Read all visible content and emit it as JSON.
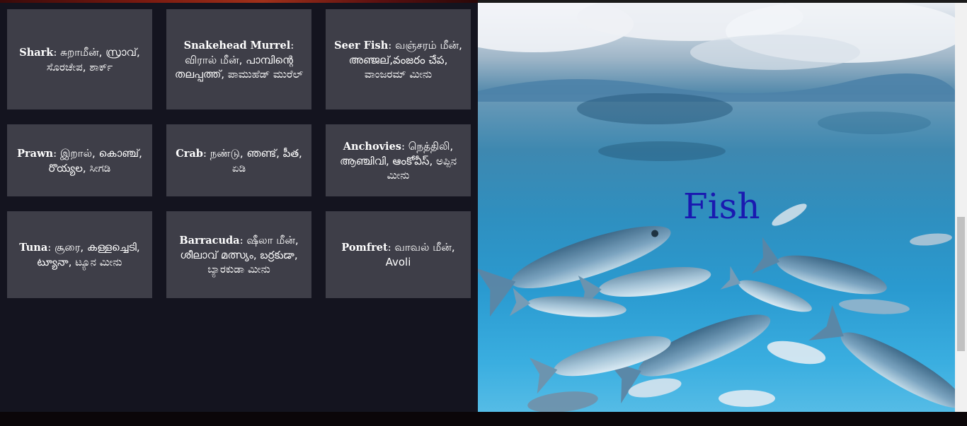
{
  "cards": [
    {
      "en": "Shark",
      "native": "சுறாமீன், സ്രാവ്, ಸೊರಚೇಪ, ಶಾರ್ಕ್"
    },
    {
      "en": "Snakehead Murrel",
      "native": "விரால் மீன், പാമ്പിന്റെ തലപ്പത്ത്, ಪಾಮುಹೆಡ್ ಮುರೆಲ್"
    },
    {
      "en": "Seer Fish",
      "native": "வஞ்சரம் மீன், അഞ്ജല്,వంజరం చేప, ವಾಂಜರಮ್ ಮೀನು"
    },
    {
      "en": "Prawn",
      "native": "இறால், കൊഞ്ച്, రొయ్యల, ಸೀಗಡಿ"
    },
    {
      "en": "Crab",
      "native": "நண்டு, ഞണ്ട്, పీత, ಏಡಿ"
    },
    {
      "en": "Anchovies",
      "native": "நெத்திலி, ആഞ്ചിവി, ఆంకోవీస్, ಅಪ್ಪಿನ ಮೀನು"
    },
    {
      "en": "Tuna",
      "native": "சூரை, കള്ളച്ചെടി, ట్యూనా, ಟ್ಯೂನ ಮೀನು"
    },
    {
      "en": "Barracuda",
      "native": "ஷீலா மீன், ശീലാവ് മത്സ്യം, బర్రకుడా, ಬ್ಯಾರಕುಡಾ ಮೀನು"
    },
    {
      "en": "Pomfret",
      "native": "வாவல் மீன், Avoli"
    }
  ],
  "hero": {
    "title": "Fish"
  }
}
